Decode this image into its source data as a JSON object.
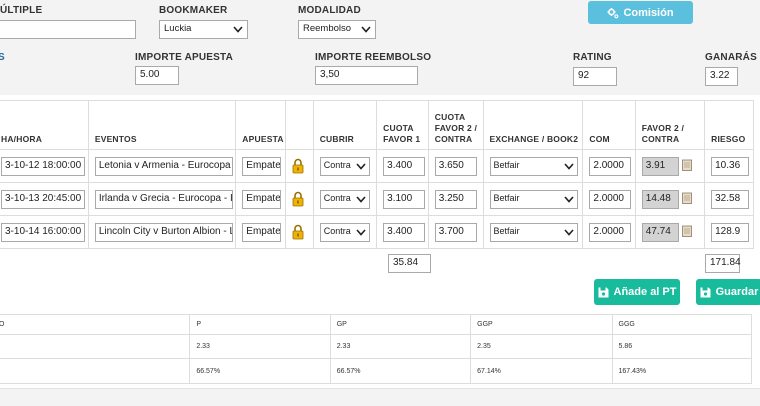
{
  "header": {
    "multiple_label": "ÚLTIPLE",
    "bookmaker_label": "BOOKMAKER",
    "bookmaker_value": "Luckia",
    "modalidad_label": "MODALIDAD",
    "modalidad_value": "Reembolso",
    "comision_button": "Comisión",
    "s_label": "S",
    "importe_apuesta_label": "IMPORTE APUESTA",
    "importe_apuesta_value": "5.00",
    "importe_reembolso_label": "IMPORTE REEMBOLSO",
    "importe_reembolso_value": "3,50",
    "rating_label": "RATING",
    "rating_value": "92",
    "ganaras_label": "GANARÁS",
    "ganaras_value": "3.22"
  },
  "table": {
    "headers": {
      "fecha": "HA/HORA",
      "eventos": "EVENTOS",
      "apuesta": "APUESTA",
      "cubrir": "CUBRIR",
      "cuota_favor_1": [
        "CUOTA",
        "FAVOR 1"
      ],
      "cuota_favor_2": [
        "CUOTA",
        "FAVOR 2 /",
        "CONTRA"
      ],
      "exchange": "EXCHANGE / BOOK2",
      "com": "COM",
      "favor_2": [
        "FAVOR 2 /",
        "CONTRA"
      ],
      "riesgo": "RIESGO"
    },
    "rows": [
      {
        "fecha": "3-10-12 18:00:00",
        "evento": "Letonia v Armenia - Eurocopa - I",
        "apuesta": "Empate",
        "cubrir": "Contra",
        "cuota1": "3.400",
        "cuota2": "3.650",
        "exchange": "Betfair",
        "com": "2.0000",
        "favor2": "3.91",
        "riesgo": "10.36"
      },
      {
        "fecha": "3-10-13 20:45:00",
        "evento": "Irlanda v Grecia - Eurocopa - Inte",
        "apuesta": "Empate",
        "cubrir": "Contra",
        "cuota1": "3.100",
        "cuota2": "3.250",
        "exchange": "Betfair",
        "com": "2.0000",
        "favor2": "14.48",
        "riesgo": "32.58"
      },
      {
        "fecha": "3-10-14 16:00:00",
        "evento": "Lincoln City v Burton Albion - Lea",
        "apuesta": "Empate",
        "cubrir": "Contra",
        "cuota1": "3.400",
        "cuota2": "3.700",
        "exchange": "Betfair",
        "com": "2.0000",
        "favor2": "47.74",
        "riesgo": "128.9"
      }
    ],
    "total_cuota": "35.84",
    "total_riesgo": "171.84"
  },
  "buttons": {
    "add_pt": "Añade al PT",
    "guardar": "Guardar"
  },
  "results": {
    "headers": [
      "O",
      "P",
      "GP",
      "GGP",
      "GGG"
    ],
    "row1": [
      "",
      "2.33",
      "2.33",
      "2.35",
      "5.86"
    ],
    "row2": [
      "",
      "66.57%",
      "66.57%",
      "67.14%",
      "167.43%"
    ]
  },
  "colors": {
    "info_button": "#5bc0de",
    "success_button": "#18bc9c",
    "lock": "#e0a800"
  }
}
